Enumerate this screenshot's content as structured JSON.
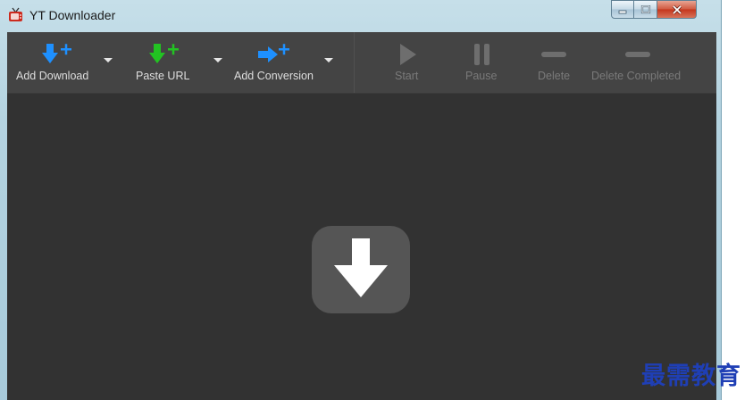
{
  "window": {
    "title": "YT Downloader",
    "controls": {
      "minimize": "minimize",
      "maximize": "maximize",
      "close": "close"
    }
  },
  "toolbar": {
    "items": [
      {
        "label": "Add Download",
        "icon": "download-arrow-plus-icon",
        "color": "#1e90ff",
        "has_dropdown": true,
        "enabled": true
      },
      {
        "label": "Paste URL",
        "icon": "paste-arrow-plus-icon",
        "color": "#22c322",
        "has_dropdown": true,
        "enabled": true
      },
      {
        "label": "Add Conversion",
        "icon": "convert-arrow-plus-icon",
        "color": "#1e90ff",
        "has_dropdown": true,
        "enabled": true
      },
      {
        "label": "Start",
        "icon": "play-icon",
        "enabled": false
      },
      {
        "label": "Pause",
        "icon": "pause-icon",
        "enabled": false
      },
      {
        "label": "Delete",
        "icon": "minus-icon",
        "enabled": false
      },
      {
        "label": "Delete Completed",
        "icon": "minus-icon",
        "enabled": false
      }
    ]
  },
  "main": {
    "empty_state_icon": "download-arrow-icon"
  },
  "watermark": {
    "text": "最需教育"
  },
  "colors": {
    "toolbar_bg": "#444444",
    "content_bg": "#323232",
    "disabled_text": "#7a7a7a",
    "watermark": "#1f3fb5"
  }
}
